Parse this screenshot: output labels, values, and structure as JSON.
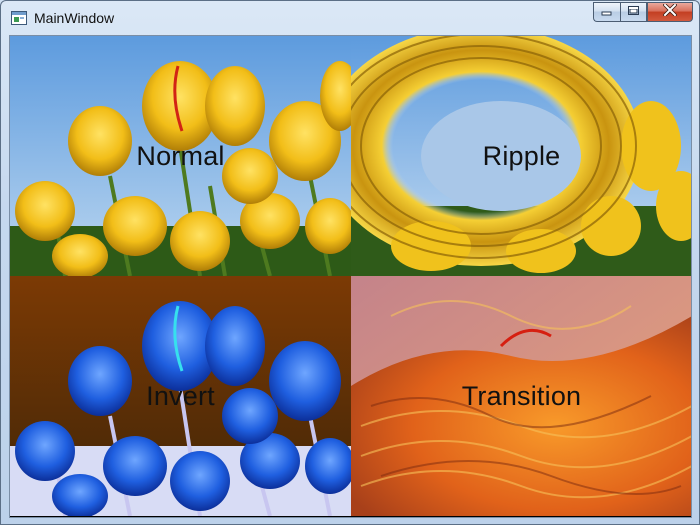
{
  "window": {
    "title": "MainWindow",
    "icon": "wpf-window-icon",
    "controls": [
      "minimize-icon",
      "maximize-icon",
      "close-icon"
    ]
  },
  "tiles": [
    {
      "label": "Normal",
      "effect": "none"
    },
    {
      "label": "Ripple",
      "effect": "ripple"
    },
    {
      "label": "Invert",
      "effect": "invert"
    },
    {
      "label": "Transition",
      "effect": "transition"
    }
  ],
  "colors": {
    "tulip_yellow": "#f2c21a",
    "sky_blue": "#7fb2e6",
    "invert_blue": "#2a6de8",
    "transition_orange": "#e8771c"
  }
}
